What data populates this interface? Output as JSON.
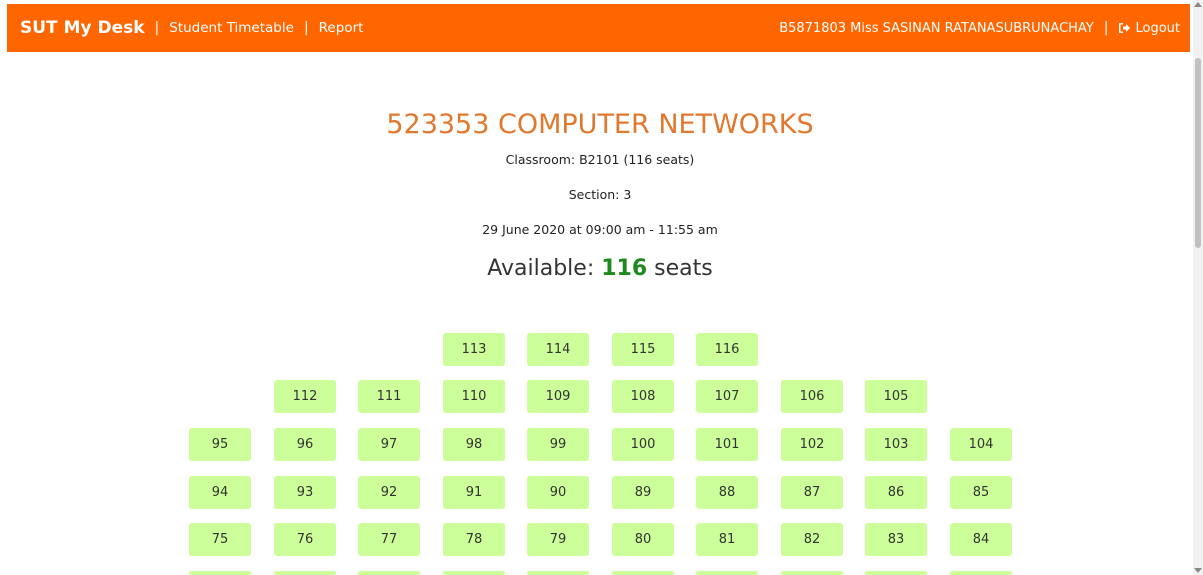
{
  "navbar": {
    "brand": "SUT My Desk",
    "separator": "|",
    "links": [
      "Student Timetable",
      "Report"
    ],
    "user": "B5871803 Miss SASINAN RATANASUBRUNACHAY",
    "logout": "Logout",
    "background_color": "#ff6600"
  },
  "course": {
    "title": "523353 COMPUTER NETWORKS",
    "classroom": "Classroom: B2101 (116 seats)",
    "section": "Section: 3",
    "datetime": "29 June 2020 at 09:00 am - 11:55 am",
    "available_label": "Available:",
    "available_count": "116",
    "available_unit": "seats"
  },
  "seat_color": "#ccff99",
  "seat_rows": [
    [
      "113",
      "114",
      "115",
      "116"
    ],
    [
      "112",
      "111",
      "110",
      "109",
      "108",
      "107",
      "106",
      "105"
    ],
    [
      "95",
      "96",
      "97",
      "98",
      "99",
      "100",
      "101",
      "102",
      "103",
      "104"
    ],
    [
      "94",
      "93",
      "92",
      "91",
      "90",
      "89",
      "88",
      "87",
      "86",
      "85"
    ],
    [
      "75",
      "76",
      "77",
      "78",
      "79",
      "80",
      "81",
      "82",
      "83",
      "84"
    ]
  ]
}
